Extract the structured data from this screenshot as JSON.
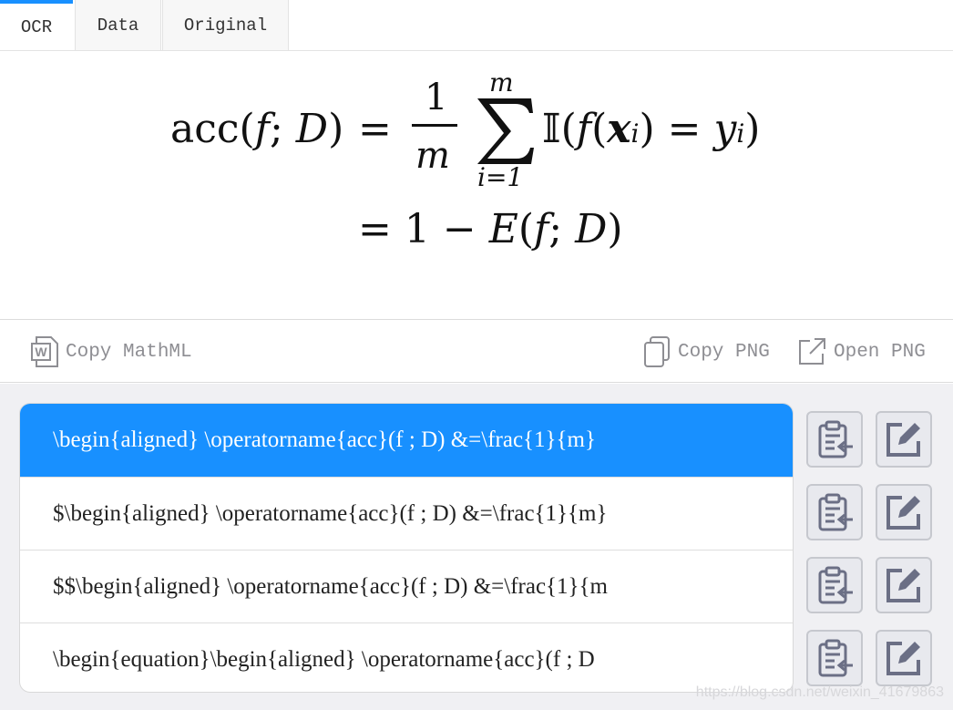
{
  "tabs": [
    {
      "label": "OCR",
      "active": true
    },
    {
      "label": "Data",
      "active": false
    },
    {
      "label": "Original",
      "active": false
    }
  ],
  "formula": {
    "line1_lhs": "acc(",
    "f": "f",
    "semi": "; ",
    "D": "D",
    "close": ")",
    "eq": "=",
    "frac_num": "1",
    "frac_den": "m",
    "sum_upper": "m",
    "sum_lower": "i=1",
    "indicator": "𝕀",
    "x": "x",
    "i": "i",
    "y": "y",
    "line2": "= 1 − ",
    "E": "E"
  },
  "actions": {
    "copy_mathml": "Copy MathML",
    "copy_png": "Copy PNG",
    "open_png": "Open PNG"
  },
  "results": [
    {
      "text": "\\begin{aligned} \\operatorname{acc}(f ; D) &=\\frac{1}{m}",
      "selected": true
    },
    {
      "text": "$\\begin{aligned} \\operatorname{acc}(f ; D) &=\\frac{1}{m}",
      "selected": false
    },
    {
      "text": "$$\\begin{aligned} \\operatorname{acc}(f ; D) &=\\frac{1}{m",
      "selected": false
    },
    {
      "text": "\\begin{equation}\\begin{aligned} \\operatorname{acc}(f ; D",
      "selected": false
    }
  ],
  "watermark": "https://blog.csdn.net/weixin_41679863",
  "colors": {
    "accent": "#1890ff",
    "muted": "#8e8e93",
    "icon": "#6b6f85"
  }
}
